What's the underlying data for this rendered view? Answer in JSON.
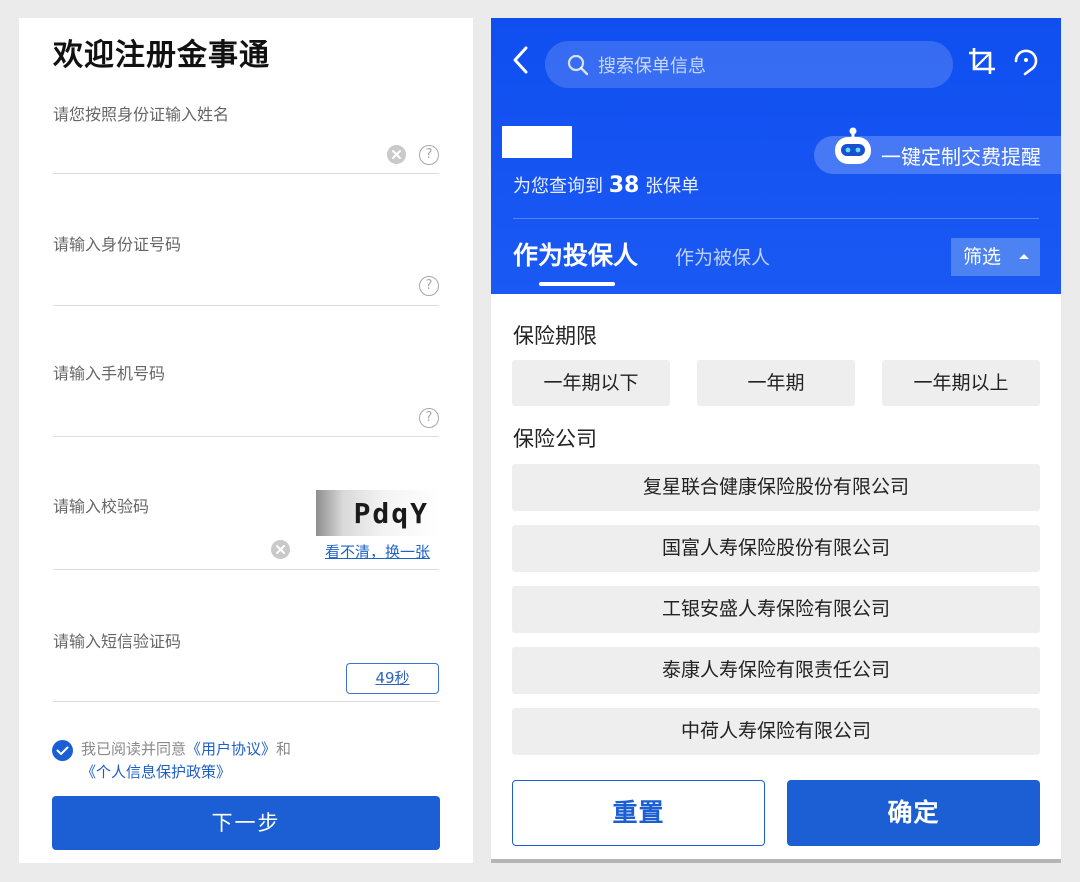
{
  "register": {
    "title": "欢迎注册金事通",
    "name_label": "请您按照身份证输入姓名",
    "id_label": "请输入身份证号码",
    "phone_label": "请输入手机号码",
    "captcha_label": "请输入校验码",
    "captcha_text": "PdqY",
    "captcha_refresh": "看不清，换一张",
    "sms_label": "请输入短信验证码",
    "countdown": "49秒",
    "agreement": {
      "prefix": "我已阅读并同意",
      "user_agreement": "《用户协议》",
      "and": "和",
      "privacy_policy": "《个人信息保护政策》"
    },
    "next_button": "下一步"
  },
  "policy": {
    "search_placeholder": "搜索保单信息",
    "remind_label": "一键定制交费提醒",
    "count_prefix": "为您查询到",
    "count_value": "38",
    "count_suffix": "张保单",
    "tabs": [
      "作为投保人",
      "作为被保人"
    ],
    "filter_label": "筛选",
    "term_section": "保险期限",
    "terms": [
      "一年期以下",
      "一年期",
      "一年期以上"
    ],
    "company_section": "保险公司",
    "companies": [
      "复星联合健康保险股份有限公司",
      "国富人寿保险股份有限公司",
      "工银安盛人寿保险有限公司",
      "泰康人寿保险有限责任公司",
      "中荷人寿保险有限公司"
    ],
    "reset_button": "重置",
    "confirm_button": "确定"
  },
  "icons": {
    "help": "?"
  },
  "colors": {
    "brand_blue": "#1c5fd4",
    "header_blue": "#1554f2",
    "chip_gray": "#eeeeee"
  }
}
